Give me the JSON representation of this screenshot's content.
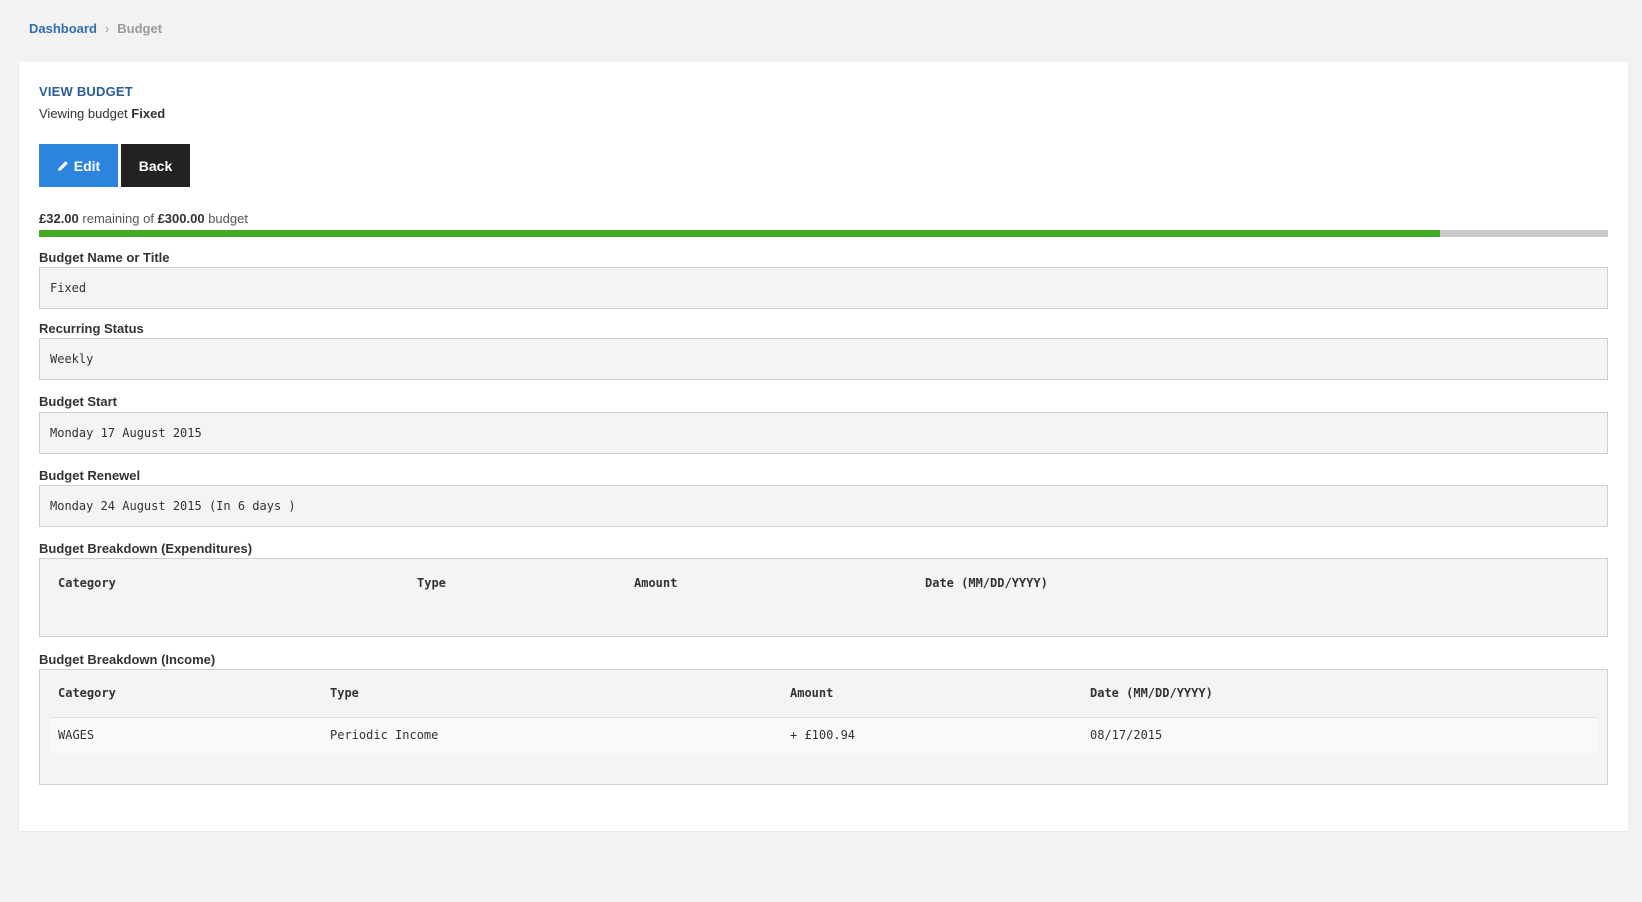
{
  "breadcrumb": {
    "home": "Dashboard",
    "separator": "›",
    "current": "Budget"
  },
  "header": {
    "title": "VIEW BUDGET",
    "subtitle_prefix": "Viewing budget",
    "budget_name": "Fixed"
  },
  "buttons": {
    "edit_label": "Edit",
    "edit_icon": "pencil-icon",
    "back_label": "Back"
  },
  "summary": {
    "remaining": "£32.00",
    "remaining_text": "remaining of",
    "total": "£300.00",
    "suffix": "budget",
    "progress_fraction": 0.893
  },
  "fields": {
    "name": {
      "label": "Budget Name or Title",
      "value": "Fixed"
    },
    "recurring": {
      "label": "Recurring Status",
      "value": "Weekly"
    },
    "start": {
      "label": "Budget Start",
      "value": "Monday 17 August 2015"
    },
    "renewal": {
      "label": "Budget Renewel",
      "value": "Monday 24 August 2015 (In 6 days )"
    }
  },
  "expenditures": {
    "label": "Budget Breakdown (Expenditures)",
    "columns": [
      "Category",
      "Type",
      "Amount",
      "Date (MM/DD/YYYY)"
    ],
    "rows": []
  },
  "income": {
    "label": "Budget Breakdown (Income)",
    "columns": [
      "Category",
      "Type",
      "Amount",
      "Date (MM/DD/YYYY)"
    ],
    "rows": [
      [
        "WAGES",
        "Periodic Income",
        "+ £100.94",
        "08/17/2015"
      ]
    ]
  },
  "colors": {
    "accent": "#2d84de",
    "title": "#2a5d9b",
    "progress": "#44aa22",
    "progress_track": "#c9c9c9",
    "back_button": "#222222"
  }
}
